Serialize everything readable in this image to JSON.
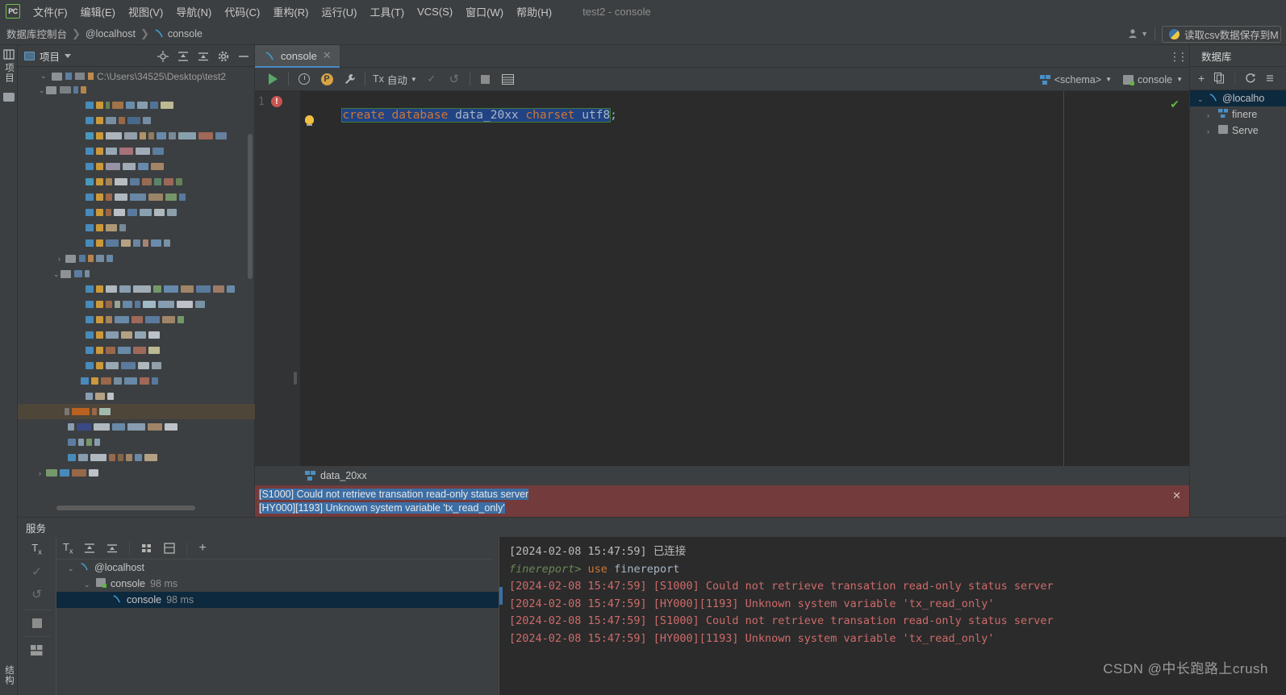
{
  "app": {
    "logo_text": "PC",
    "window_title": "test2 - console",
    "watermark": "CSDN @中长跑路上crush"
  },
  "menubar": {
    "items": [
      {
        "label": "文件(F)"
      },
      {
        "label": "编辑(E)"
      },
      {
        "label": "视图(V)"
      },
      {
        "label": "导航(N)"
      },
      {
        "label": "代码(C)"
      },
      {
        "label": "重构(R)"
      },
      {
        "label": "运行(U)"
      },
      {
        "label": "工具(T)"
      },
      {
        "label": "VCS(S)"
      },
      {
        "label": "窗口(W)"
      },
      {
        "label": "帮助(H)"
      }
    ]
  },
  "navbar": {
    "breadcrumbs": [
      "数据库控制台",
      "@localhost",
      "console"
    ],
    "separator": "❯",
    "run_config": "读取csv数据保存到M",
    "person_icon": "person-icon"
  },
  "left_strip": {
    "project_label": "项目",
    "bottom_label": "结构"
  },
  "project_panel": {
    "title": "项目",
    "path": "C:\\Users\\34525\\Desktop\\test2",
    "tool_icons": [
      "locate-icon",
      "expand-all-icon",
      "collapse-all-icon",
      "settings-icon",
      "hide-icon"
    ],
    "tree_rows": [
      {
        "indent": 26,
        "arrow": "v",
        "folder": true,
        "blocks": [
          [
            14,
            "#7f858a"
          ],
          [
            6,
            "#5c7fa3"
          ],
          [
            7,
            "#c08a4e"
          ]
        ]
      },
      {
        "indent": 84,
        "arrow": "",
        "blocks": [
          [
            10,
            "#4a90c4"
          ],
          [
            9,
            "#d8a03a"
          ],
          [
            5,
            "#6a8759"
          ],
          [
            14,
            "#a9774a"
          ],
          [
            11,
            "#6d94b5"
          ],
          [
            13,
            "#8fa5b8"
          ],
          [
            10,
            "#5577a0"
          ],
          [
            16,
            "#c8c49a"
          ]
        ]
      },
      {
        "indent": 84,
        "arrow": "",
        "blocks": [
          [
            10,
            "#4a90c4"
          ],
          [
            9,
            "#d8a03a"
          ],
          [
            13,
            "#7e95aa"
          ],
          [
            8,
            "#a06b4a"
          ],
          [
            16,
            "#4b6c91"
          ],
          [
            10,
            "#7b93ab"
          ]
        ]
      },
      {
        "indent": 84,
        "arrow": "",
        "blocks": [
          [
            10,
            "#4aa0c4"
          ],
          [
            9,
            "#d8a03a"
          ],
          [
            20,
            "#b5bec7"
          ],
          [
            16,
            "#9aa7b3"
          ],
          [
            8,
            "#bb9b6a"
          ],
          [
            7,
            "#9a7f5e"
          ],
          [
            12,
            "#6d8fb0"
          ],
          [
            9,
            "#7e8f9e"
          ],
          [
            22,
            "#8fa8b5"
          ],
          [
            18,
            "#a86b5a"
          ],
          [
            14,
            "#6b86a5"
          ]
        ]
      },
      {
        "indent": 84,
        "arrow": "",
        "blocks": [
          [
            10,
            "#4a90c4"
          ],
          [
            9,
            "#d8a03a"
          ],
          [
            14,
            "#9fb0bd"
          ],
          [
            17,
            "#b0767f"
          ],
          [
            18,
            "#a9b4bf"
          ],
          [
            14,
            "#5e82a8"
          ]
        ]
      },
      {
        "indent": 84,
        "arrow": "",
        "blocks": [
          [
            10,
            "#4a90c4"
          ],
          [
            9,
            "#d8a03a"
          ],
          [
            18,
            "#9e9ab0"
          ],
          [
            16,
            "#a9b4bf"
          ],
          [
            13,
            "#6d90b5"
          ],
          [
            16,
            "#ab8a6a"
          ]
        ]
      },
      {
        "indent": 84,
        "arrow": "",
        "blocks": [
          [
            10,
            "#4aa0c4"
          ],
          [
            9,
            "#d8a03a"
          ],
          [
            8,
            "#b08a5a"
          ],
          [
            16,
            "#c3c8cc"
          ],
          [
            12,
            "#5f7fa2"
          ],
          [
            12,
            "#9d6f55"
          ],
          [
            9,
            "#5d8a6d"
          ],
          [
            12,
            "#a36a5a"
          ],
          [
            8,
            "#6a8759"
          ]
        ]
      },
      {
        "indent": 84,
        "arrow": "",
        "blocks": [
          [
            10,
            "#4a90c4"
          ],
          [
            9,
            "#d8a03a"
          ],
          [
            8,
            "#a86a4f"
          ],
          [
            16,
            "#b9c2c9"
          ],
          [
            20,
            "#6d8db0"
          ],
          [
            18,
            "#a48a6a"
          ],
          [
            14,
            "#7a9d6c"
          ],
          [
            8,
            "#5a7ea5"
          ]
        ]
      },
      {
        "indent": 84,
        "arrow": "",
        "blocks": [
          [
            10,
            "#4a90c4"
          ],
          [
            9,
            "#d8a03a"
          ],
          [
            7,
            "#9c6a4a"
          ],
          [
            14,
            "#c5cbd0"
          ],
          [
            12,
            "#5d7fa5"
          ],
          [
            15,
            "#8fa9bb"
          ],
          [
            13,
            "#b9c2c9"
          ],
          [
            12,
            "#93a7b5"
          ]
        ]
      },
      {
        "indent": 84,
        "arrow": "",
        "blocks": [
          [
            10,
            "#4a90c4"
          ],
          [
            9,
            "#d8a03a"
          ],
          [
            14,
            "#b8a07a"
          ],
          [
            8,
            "#7c8fa0"
          ]
        ]
      },
      {
        "indent": 84,
        "arrow": "",
        "blocks": [
          [
            10,
            "#4a90c4"
          ],
          [
            9,
            "#d8a03a"
          ],
          [
            16,
            "#5f7fa5"
          ],
          [
            12,
            "#bfa98a"
          ],
          [
            9,
            "#6e8ba8"
          ],
          [
            7,
            "#b08a7a"
          ],
          [
            13,
            "#6f93b5"
          ],
          [
            8,
            "#7f99ad"
          ]
        ]
      },
      {
        "indent": 50,
        "arrow": ">",
        "folder": true,
        "blocks": [
          [
            8,
            "#5a7ea5"
          ],
          [
            7,
            "#c08a4e"
          ],
          [
            10,
            "#7c93a8"
          ],
          [
            8,
            "#6d8fb0"
          ]
        ]
      },
      {
        "indent": 44,
        "arrow": "v",
        "folder": true,
        "blocks": [
          [
            10,
            "#5f82a8"
          ],
          [
            6,
            "#7c93a8"
          ]
        ]
      },
      {
        "indent": 84,
        "arrow": "",
        "blocks": [
          [
            10,
            "#4a90c4"
          ],
          [
            9,
            "#d8a03a"
          ],
          [
            14,
            "#b9c2c9"
          ],
          [
            14,
            "#8fa5b8"
          ],
          [
            22,
            "#aab5c0"
          ],
          [
            10,
            "#7ba06e"
          ],
          [
            18,
            "#6b8fb5"
          ],
          [
            16,
            "#a88a6a"
          ],
          [
            18,
            "#5d7fa5"
          ],
          [
            14,
            "#a57f6a"
          ],
          [
            10,
            "#6d8fb0"
          ]
        ]
      },
      {
        "indent": 84,
        "arrow": "",
        "blocks": [
          [
            10,
            "#4a90c4"
          ],
          [
            9,
            "#d8a03a"
          ],
          [
            8,
            "#a06b4a"
          ],
          [
            7,
            "#9db09a"
          ],
          [
            12,
            "#6d8fb0"
          ],
          [
            7,
            "#5a7ea5"
          ],
          [
            16,
            "#a9c4d0"
          ],
          [
            20,
            "#8fa5b8"
          ],
          [
            20,
            "#c8cdd2"
          ],
          [
            12,
            "#7f99ad"
          ]
        ]
      },
      {
        "indent": 84,
        "arrow": "",
        "blocks": [
          [
            10,
            "#4a90c4"
          ],
          [
            9,
            "#d8a03a"
          ],
          [
            8,
            "#b08a5a"
          ],
          [
            18,
            "#6d8fb0"
          ],
          [
            14,
            "#a86b5a"
          ],
          [
            18,
            "#5f7fa5"
          ],
          [
            16,
            "#a88a6a"
          ],
          [
            8,
            "#7ba06e"
          ]
        ]
      },
      {
        "indent": 84,
        "arrow": "",
        "blocks": [
          [
            10,
            "#4a90c4"
          ],
          [
            9,
            "#d8a03a"
          ],
          [
            16,
            "#8fa5b8"
          ],
          [
            14,
            "#bfa98a"
          ],
          [
            14,
            "#9ab0c0"
          ],
          [
            14,
            "#c8cdd2"
          ]
        ]
      },
      {
        "indent": 84,
        "arrow": "",
        "blocks": [
          [
            10,
            "#4a90c4"
          ],
          [
            9,
            "#d8a03a"
          ],
          [
            12,
            "#a06b4a"
          ],
          [
            16,
            "#6d8fb0"
          ],
          [
            16,
            "#a86b5a"
          ],
          [
            14,
            "#c8c49a"
          ]
        ]
      },
      {
        "indent": 84,
        "arrow": "",
        "blocks": [
          [
            10,
            "#4a90c4"
          ],
          [
            9,
            "#d8a03a"
          ],
          [
            16,
            "#9fb0bd"
          ],
          [
            18,
            "#5f7fa5"
          ],
          [
            14,
            "#b9c2c9"
          ],
          [
            12,
            "#9aa7b3"
          ]
        ]
      },
      {
        "indent": 78,
        "arrow": "",
        "blocks": [
          [
            10,
            "#4a90c4"
          ],
          [
            9,
            "#d8a03a"
          ],
          [
            13,
            "#a06b4a"
          ],
          [
            10,
            "#7c93a8"
          ],
          [
            16,
            "#6d8fb0"
          ],
          [
            12,
            "#a86b5a"
          ],
          [
            8,
            "#5a7ea5"
          ]
        ]
      },
      {
        "indent": 84,
        "arrow": "",
        "blocks": [
          [
            9,
            "#8fa5b8"
          ],
          [
            12,
            "#bfa98a"
          ],
          [
            8,
            "#c8cdd2"
          ]
        ]
      },
      {
        "indent": 58,
        "arrow": "",
        "selected": true,
        "blocks": [
          [
            6,
            "#7c7c7c"
          ],
          [
            22,
            "#c2641e"
          ],
          [
            6,
            "#a06b4a"
          ],
          [
            14,
            "#a9c4b8"
          ]
        ]
      },
      {
        "indent": 62,
        "arrow": "",
        "blocks": [
          [
            8,
            "#8fa5b8"
          ],
          [
            18,
            "#3b4a8a"
          ],
          [
            20,
            "#b9c2c9"
          ],
          [
            16,
            "#6d8fb0"
          ],
          [
            22,
            "#8fa5b8"
          ],
          [
            18,
            "#a88a6a"
          ],
          [
            16,
            "#c8cdd2"
          ]
        ]
      },
      {
        "indent": 62,
        "arrow": "",
        "blocks": [
          [
            10,
            "#5f82a8"
          ],
          [
            7,
            "#8fa5b8"
          ],
          [
            7,
            "#7ba06e"
          ],
          [
            7,
            "#8fa5b8"
          ]
        ]
      },
      {
        "indent": 62,
        "arrow": "",
        "blocks": [
          [
            10,
            "#4a90c4"
          ],
          [
            12,
            "#8fa5b8"
          ],
          [
            20,
            "#b9c2c9"
          ],
          [
            8,
            "#a06b4a"
          ],
          [
            7,
            "#8a6a4a"
          ],
          [
            8,
            "#a88a6a"
          ],
          [
            9,
            "#6d8fb0"
          ],
          [
            16,
            "#bfa98a"
          ]
        ]
      },
      {
        "indent": 26,
        "arrow": ">",
        "blocks": [
          [
            14,
            "#7ba06e"
          ],
          [
            12,
            "#4a90c4"
          ],
          [
            18,
            "#a06b4a"
          ],
          [
            12,
            "#c8cdd2"
          ]
        ]
      }
    ]
  },
  "editor": {
    "tab_label": "console",
    "tab_close": "✕",
    "kebab": "⋮",
    "toolbar": {
      "run": "run-icon",
      "history": "history-icon",
      "p_badge": "P",
      "wrench": "wrench-icon",
      "tx_prefix": "Tx",
      "tx_value": "自动",
      "commit": "✓",
      "rollback": "↺",
      "stop": "stop-icon",
      "table": "table-icon",
      "schema_label": "<schema>",
      "console_label": "console"
    },
    "line_number": "1",
    "code": {
      "kw1": "create",
      "kw2": "database",
      "name": "data_20xx",
      "kw3": "charset",
      "value": "utf8",
      "semi": ";"
    }
  },
  "result": {
    "tab_label": "data_20xx",
    "error_lines": [
      "[S1000] Could not retrieve transation read-only status server",
      "[HY000][1193] Unknown system variable 'tx_read_only'"
    ],
    "close": "✕"
  },
  "services": {
    "title": "服务",
    "tools": [
      "tx-icon",
      "expand-all-icon",
      "collapse-all-icon",
      "group-icon",
      "layout-icon",
      "add-icon"
    ],
    "left_tools": [
      "tx-icon",
      "commit-icon",
      "rollback-icon",
      "stop-icon",
      "layout-icon"
    ],
    "tree": [
      {
        "indent": 8,
        "arrow": "v",
        "icon": "mysql-icon",
        "label": "@localhost",
        "time": ""
      },
      {
        "indent": 28,
        "arrow": "v",
        "icon": "console-icon",
        "label": "console",
        "time": "98 ms"
      },
      {
        "indent": 48,
        "arrow": "",
        "icon": "mysql-icon",
        "label": "console",
        "time": "98 ms",
        "selected": true
      }
    ],
    "log": [
      {
        "parts": [
          {
            "t": "[2024-02-08 15:47:59] ",
            "c": "white"
          },
          {
            "t": "已连接",
            "c": "white"
          }
        ]
      },
      {
        "parts": [
          {
            "t": "finereport> ",
            "c": "green"
          },
          {
            "t": "use ",
            "c": "kw"
          },
          {
            "t": "finereport",
            "c": "plain"
          }
        ]
      },
      {
        "parts": [
          {
            "t": "[2024-02-08 15:47:59] [S1000] Could not retrieve transation read-only status server",
            "c": "red"
          }
        ]
      },
      {
        "parts": [
          {
            "t": "[2024-02-08 15:47:59] [HY000][1193] Unknown system variable 'tx_read_only'",
            "c": "red"
          }
        ]
      },
      {
        "parts": [
          {
            "t": "[2024-02-08 15:47:59] [S1000] Could not retrieve transation read-only status server",
            "c": "red"
          }
        ]
      },
      {
        "parts": [
          {
            "t": "[2024-02-08 15:47:59] [HY000][1193] Unknown system variable 'tx_read_only'",
            "c": "red"
          }
        ]
      }
    ]
  },
  "database_panel": {
    "title": "数据库",
    "tools": [
      "add-icon",
      "copy-icon",
      "refresh-icon",
      "more-icon"
    ],
    "kebab": "⋮",
    "rows": [
      {
        "indent": 4,
        "arrow": "v",
        "icon": "mysql-icon",
        "label": "@localho",
        "selected": true
      },
      {
        "indent": 16,
        "arrow": ">",
        "icon": "schema-icon",
        "label": "finere"
      },
      {
        "indent": 16,
        "arrow": ">",
        "icon": "server-icon",
        "label": "Serve"
      }
    ]
  },
  "colors": {
    "accent_blue": "#4a88c7",
    "error_red": "#733b3b",
    "selection_blue": "#214283",
    "run_green": "#59a869",
    "bg": "#3c3f41",
    "editor_bg": "#2b2b2b"
  }
}
